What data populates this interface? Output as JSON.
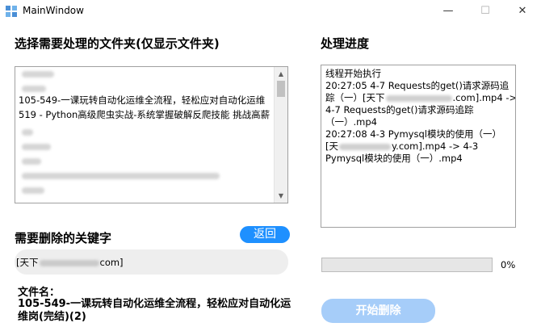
{
  "window": {
    "title": "MainWindow",
    "minimize_glyph": "—",
    "maximize_glyph": "☐",
    "close_glyph": "✕"
  },
  "folder_panel": {
    "title": "选择需要处理的文件夹(仅显示文件夹)",
    "visible_items": [
      "105-549-一课玩转自动化运维全流程，轻松应对自动化运维",
      "519 - Python高级爬虫实战-系统掌握破解反爬技能 挑战高薪"
    ],
    "scroll_up_glyph": "▲",
    "scroll_down_glyph": "▼"
  },
  "keyword_panel": {
    "title": "需要删除的关键字",
    "back_button": "返回",
    "input_prefix": "[天下",
    "input_suffix": "com]"
  },
  "filename": {
    "label": "文件名：",
    "value": "105-549-一课玩转自动化运维全流程，轻松应对自动化运维岗(完结)(2)"
  },
  "progress_panel": {
    "title": "处理进度",
    "log": {
      "l1": "线程开始执行",
      "l2": "20:27:05   4-7 Requests的get()请求源码追",
      "l3a": "踪（一）[天下",
      "l3b": ".com].mp4 ->",
      "l4": "4-7 Requests的get()请求源码追踪",
      "l5": "（一）.mp4",
      "l6": "20:27:08   4-3 Pymysql模块的使用（一）",
      "l7a": "[天",
      "l7b": "y.com].mp4 -> 4-3",
      "l8": "Pymysql模块的使用（一）.mp4"
    },
    "progress_value": 0,
    "progress_text": "0%",
    "start_button": "开始删除"
  },
  "colors": {
    "back_button_bg": "#1e90ff",
    "start_button_bg": "#a6cdf9",
    "progress_fill": "#06b025"
  }
}
